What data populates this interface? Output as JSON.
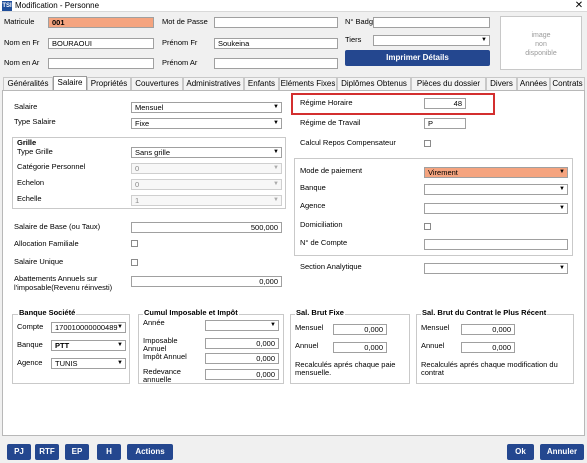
{
  "window": {
    "title": "Modification - Personne",
    "app_icon": "TSI",
    "close": "✕"
  },
  "header": {
    "matricule_label": "Matricule",
    "matricule": "001",
    "mot_de_passe_label": "Mot de Passe",
    "mot_de_passe": "",
    "n_badge_label": "N° Badge",
    "n_badge": "",
    "nom_fr_label": "Nom en Fr",
    "nom_fr": "BOURAOUI",
    "prenom_fr_label": "Prénom Fr",
    "prenom_fr": "Soukeina",
    "tiers_label": "Tiers",
    "tiers": "",
    "nom_ar_label": "Nom en Ar",
    "nom_ar": "",
    "prenom_ar_label": "Prénom Ar",
    "prenom_ar": "",
    "imprimer_label": "Imprimer Détails",
    "image_placeholder": [
      "image",
      "non",
      "disponible"
    ]
  },
  "tabs": [
    "Généralités",
    "Salaire",
    "Propriétés",
    "Couvertures",
    "Administratives",
    "Enfants",
    "Eléments Fixes",
    "Diplômes Obtenus",
    "Pièces du dossier",
    "Divers",
    "Années",
    "Contrats"
  ],
  "active_tab": "Salaire",
  "salaire": {
    "salaire_label": "Salaire",
    "salaire": "Mensuel",
    "type_salaire_label": "Type Salaire",
    "type_salaire": "Fixe",
    "grille_title": "Grille",
    "type_grille_label": "Type Grille",
    "type_grille": "Sans grille",
    "categorie_label": "Catégorie Personnel",
    "categorie": "0",
    "echelon_label": "Echelon",
    "echelon": "0",
    "echelle_label": "Echelle",
    "echelle": "1",
    "salaire_base_label": "Salaire de Base (ou Taux)",
    "salaire_base": "500,000",
    "allocation_label": "Allocation Familiale",
    "salaire_unique_label": "Salaire Unique",
    "abattements_label_1": "Abattements Annuels sur",
    "abattements_label_2": "l'imposable(Revenu réinvesti)",
    "abattements": "0,000"
  },
  "right": {
    "regime_horaire_label": "Régime Horaire",
    "regime_horaire": "48",
    "regime_travail_label": "Régime de Travail",
    "regime_travail": "P",
    "calcul_repos_label": "Calcul Repos Compensateur",
    "mode_paiement_label": "Mode de paiement",
    "mode_paiement": "Virement",
    "banque_label": "Banque",
    "banque": "",
    "agence_label": "Agence",
    "agence": "",
    "domiciliation_label": "Domiciliation",
    "n_compte_label": "N° de Compte",
    "n_compte": "",
    "section_label": "Section Analytique",
    "section": ""
  },
  "banque_societe": {
    "title": "Banque Société",
    "compte_label": "Compte",
    "compte": "170010000000489",
    "banque_label": "Banque",
    "banque": "PTT",
    "agence_label": "Agence",
    "agence": "TUNIS"
  },
  "cumul": {
    "title": "Cumul Imposable et Impôt",
    "annee_label": "Année",
    "annee": "",
    "imposable_label_1": "Imposable",
    "imposable_label_2": "Annuel",
    "imposable": "0,000",
    "impot_label": "Impôt Annuel",
    "impot": "0,000",
    "redevance_label_1": "Redevance",
    "redevance_label_2": "annuelle",
    "redevance": "0,000"
  },
  "sal_brut_fixe": {
    "title": "Sal. Brut Fixe",
    "mensuel_label": "Mensuel",
    "mensuel": "0,000",
    "annuel_label": "Annuel",
    "annuel": "0,000",
    "note_1": "Recalculés aprés chaque paie",
    "note_2": "mensuelle."
  },
  "sal_brut_contrat": {
    "title": "Sal. Brut du Contrat le Plus Récent",
    "mensuel_label": "Mensuel",
    "mensuel": "0,000",
    "annuel_label": "Annuel",
    "annuel": "0,000",
    "note_1": "Recalculés aprés chaque modification du",
    "note_2": "contrat"
  },
  "bottom": {
    "pj": "PJ",
    "rtf": "RTF",
    "ep": "EP",
    "h": "H",
    "actions": "Actions",
    "ok": "Ok",
    "annuler": "Annuler"
  },
  "colors": {
    "accent": "#24478f",
    "highlight": "#f5a47f",
    "highlight_box": "#d32f2f"
  },
  "icons": {
    "dropdown": "chevron-down-icon",
    "close": "close-icon"
  }
}
